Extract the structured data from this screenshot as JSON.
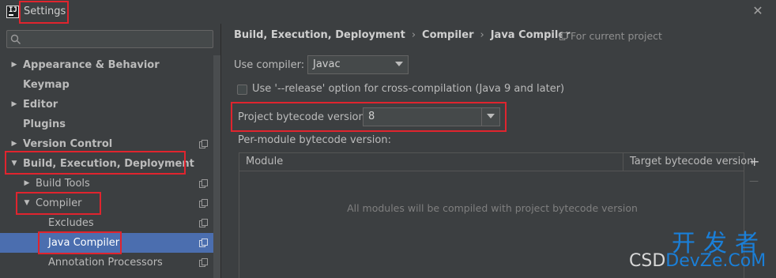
{
  "window": {
    "title": "Settings"
  },
  "sidebar": {
    "search": {
      "placeholder": ""
    },
    "items": [
      {
        "label": "Appearance & Behavior",
        "arrow": "▶"
      },
      {
        "label": "Keymap",
        "arrow": ""
      },
      {
        "label": "Editor",
        "arrow": "▶"
      },
      {
        "label": "Plugins",
        "arrow": ""
      },
      {
        "label": "Version Control",
        "arrow": "▶"
      },
      {
        "label": "Build, Execution, Deployment",
        "arrow": "▼"
      },
      {
        "label": "Build Tools",
        "arrow": "▶"
      },
      {
        "label": "Compiler",
        "arrow": "▼"
      },
      {
        "label": "Excludes",
        "arrow": ""
      },
      {
        "label": "Java Compiler",
        "arrow": ""
      },
      {
        "label": "Annotation Processors",
        "arrow": ""
      }
    ]
  },
  "main": {
    "breadcrumb": [
      "Build, Execution, Deployment",
      "Compiler",
      "Java Compiler"
    ],
    "breadcrumb_sep": "›",
    "for_project": "For current project",
    "use_compiler_label": "Use compiler:",
    "use_compiler_value": "Javac",
    "release_option_label": "Use '--release' option for cross-compilation (Java 9 and later)",
    "bytecode_label": "Project bytecode version:",
    "bytecode_value": "8",
    "per_module_label": "Per-module bytecode version:",
    "table": {
      "columns": [
        "Module",
        "Target bytecode version"
      ],
      "empty_text": "All modules will be compiled with project bytecode version"
    },
    "add_tool": "+",
    "remove_tool": "—"
  },
  "watermark": {
    "top": "开发者",
    "bottom_prefix": "CSD",
    "bottom_brand": "DevZe.CoM"
  },
  "colors": {
    "selection": "#4b6eaf",
    "highlight": "#e0242e",
    "background": "#3c3f41",
    "watermark_blue": "#1a7fd8"
  }
}
